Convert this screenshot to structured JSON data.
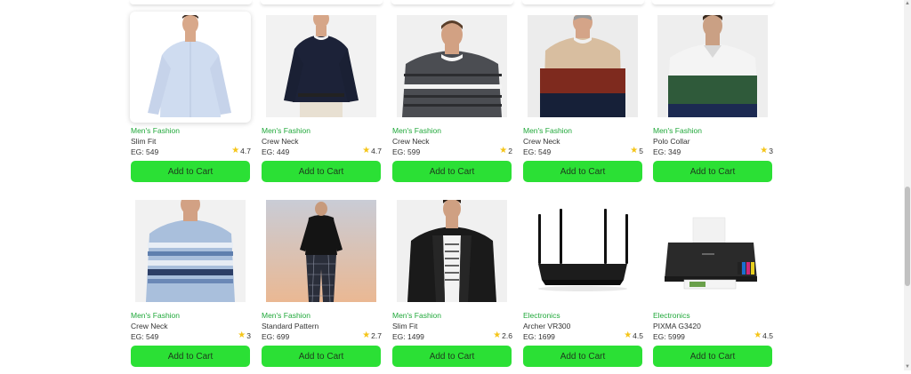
{
  "products": [
    {
      "category": "Men's Fashion",
      "title": "Slim Fit",
      "price": "EG: 549",
      "rating": "4.7",
      "button": "Add to Cart",
      "image": "light-blue-shirt",
      "highlighted": true
    },
    {
      "category": "Men's Fashion",
      "title": "Crew Neck",
      "price": "EG: 449",
      "rating": "4.7",
      "button": "Add to Cart",
      "image": "navy-sweater"
    },
    {
      "category": "Men's Fashion",
      "title": "Crew Neck",
      "price": "EG: 599",
      "rating": "2",
      "button": "Add to Cart",
      "image": "grey-striped-sweater"
    },
    {
      "category": "Men's Fashion",
      "title": "Crew Neck",
      "price": "EG: 549",
      "rating": "5",
      "button": "Add to Cart",
      "image": "colorblock-sweater"
    },
    {
      "category": "Men's Fashion",
      "title": "Polo Collar",
      "price": "EG: 349",
      "rating": "3",
      "button": "Add to Cart",
      "image": "green-polo"
    },
    {
      "category": "Men's Fashion",
      "title": "Crew Neck",
      "price": "EG: 549",
      "rating": "3",
      "button": "Add to Cart",
      "image": "blue-striped-sweater"
    },
    {
      "category": "Men's Fashion",
      "title": "Standard Pattern",
      "price": "EG: 699",
      "rating": "2.7",
      "button": "Add to Cart",
      "image": "black-tee-plaid"
    },
    {
      "category": "Men's Fashion",
      "title": "Slim Fit",
      "price": "EG: 1499",
      "rating": "2.6",
      "button": "Add to Cart",
      "image": "leather-jacket"
    },
    {
      "category": "Electronics",
      "title": "Archer VR300",
      "price": "EG: 1699",
      "rating": "4.5",
      "button": "Add to Cart",
      "image": "wifi-router"
    },
    {
      "category": "Electronics",
      "title": "PIXMA G3420",
      "price": "EG: 5999",
      "rating": "4.5",
      "button": "Add to Cart",
      "image": "inkjet-printer"
    }
  ],
  "colors": {
    "accent_button": "#2be035",
    "category_text": "#20a83a",
    "star": "#f5c518"
  },
  "icons": {
    "rating": "star-icon"
  }
}
